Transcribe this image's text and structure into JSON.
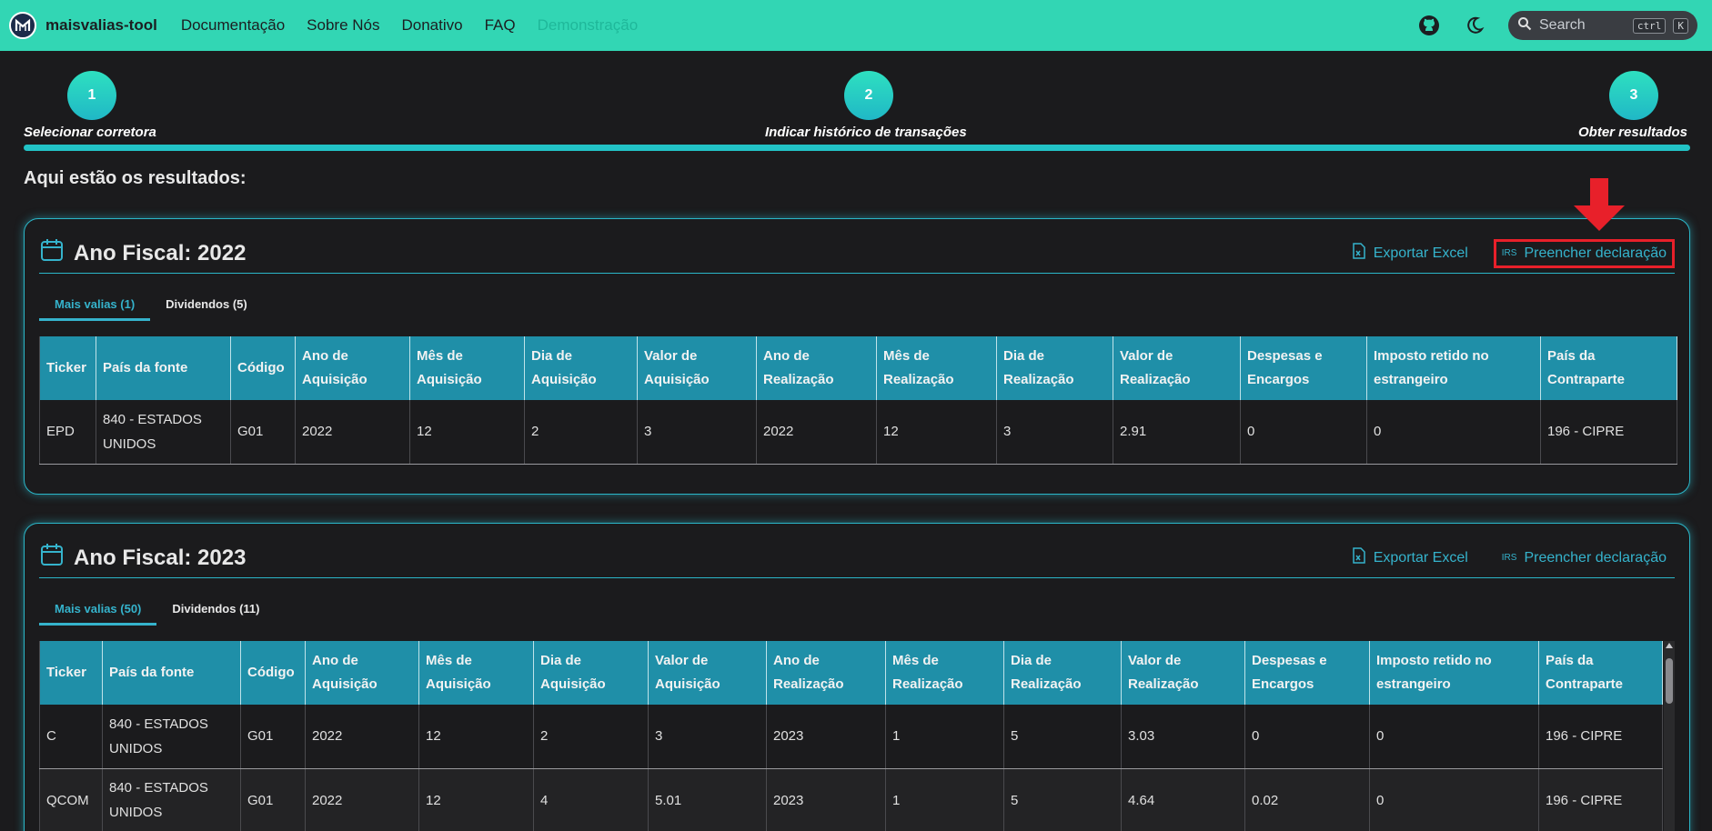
{
  "navbar": {
    "brand": "maisvalias-tool",
    "links": [
      "Documentação",
      "Sobre Nós",
      "Donativo",
      "FAQ"
    ],
    "demo_link": "Demonstração",
    "search_placeholder": "Search",
    "kbd_ctrl": "ctrl",
    "kbd_k": "K"
  },
  "stepper": {
    "steps": [
      {
        "number": "1",
        "label": "Selecionar corretora"
      },
      {
        "number": "2",
        "label": "Indicar histórico de transações"
      },
      {
        "number": "3",
        "label": "Obter resultados"
      }
    ]
  },
  "results_heading": "Aqui estão os resultados:",
  "columns": [
    "Ticker",
    "País da fonte",
    "Código",
    "Ano de Aquisição",
    "Mês de Aquisição",
    "Dia de Aquisição",
    "Valor de Aquisição",
    "Ano de Realização",
    "Mês de Realização",
    "Dia de Realização",
    "Valor de Realização",
    "Despesas e Encargos",
    "Imposto retido no estrangeiro",
    "País da Contraparte"
  ],
  "actions": {
    "export": "Exportar Excel",
    "irs": "IRS",
    "fill": "Preencher declaração"
  },
  "colors": {
    "accent": "#32d6b4",
    "table_header": "#1f8fa8",
    "highlight": "#e8202a"
  },
  "cards": [
    {
      "title": "Ano Fiscal: 2022",
      "tabs": [
        "Mais valias (1)",
        "Dividendos (5)"
      ],
      "rows": [
        [
          "EPD",
          "840 - ESTADOS UNIDOS",
          "G01",
          "2022",
          "12",
          "2",
          "3",
          "2022",
          "12",
          "3",
          "2.91",
          "0",
          "0",
          "196 - CIPRE"
        ]
      ]
    },
    {
      "title": "Ano Fiscal: 2023",
      "tabs": [
        "Mais valias (50)",
        "Dividendos (11)"
      ],
      "rows": [
        [
          "C",
          "840 - ESTADOS UNIDOS",
          "G01",
          "2022",
          "12",
          "2",
          "3",
          "2023",
          "1",
          "5",
          "3.03",
          "0",
          "0",
          "196 - CIPRE"
        ],
        [
          "QCOM",
          "840 - ESTADOS UNIDOS",
          "G01",
          "2022",
          "12",
          "4",
          "5.01",
          "2023",
          "1",
          "5",
          "4.64",
          "0.02",
          "0",
          "196 - CIPRE"
        ]
      ]
    }
  ]
}
